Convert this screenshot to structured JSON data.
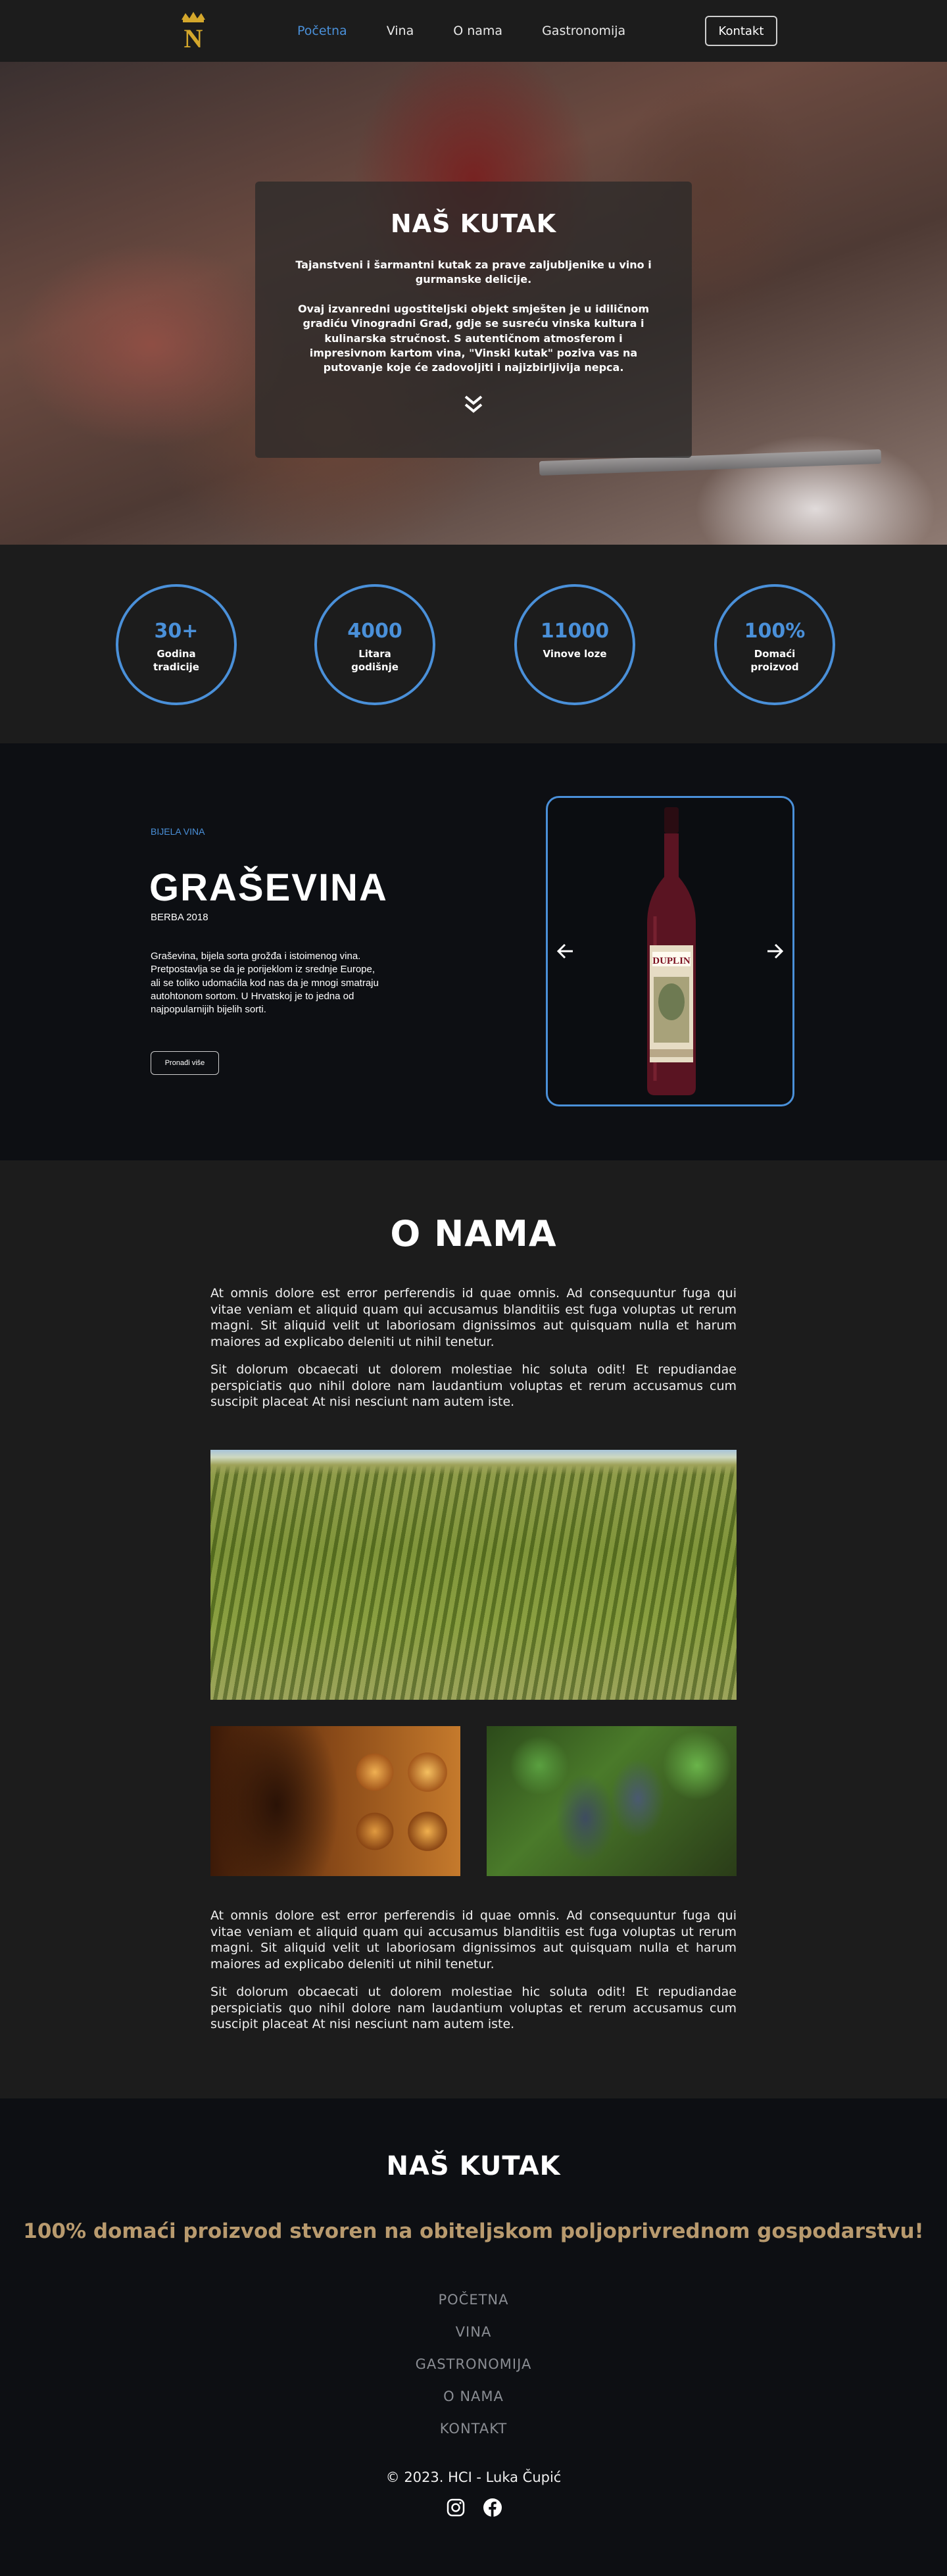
{
  "nav": {
    "links": [
      "Početna",
      "Vina",
      "O nama",
      "Gastronomija"
    ],
    "active_index": 0,
    "cta": "Kontakt",
    "logo_letter": "N"
  },
  "hero": {
    "title": "NAŠ KUTAK",
    "lead": "Tajanstveni i šarmantni kutak za prave zaljubljenike u vino i gurmanske delicije.",
    "body": "Ovaj izvanredni ugostiteljski objekt smješten je u idiličnom gradiću Vinogradni Grad, gdje se susreću vinska kultura i kulinarska stručnost. S autentičnom atmosferom i impresivnom kartom vina, \"Vinski kutak\" poziva vas na putovanje koje će zadovoljiti i najizbirljivija nepca.",
    "scroll_icon": "double-chevron-down-icon"
  },
  "stats": [
    {
      "value": "30+",
      "label": "Godina tradicije"
    },
    {
      "value": "4000",
      "label": "Litara godišnje"
    },
    {
      "value": "11000",
      "label": "Vinove loze"
    },
    {
      "value": "100%",
      "label": "Domaći proizvod"
    }
  ],
  "wine": {
    "category": "BIJELA VINA",
    "name": "GRAŠEVINA",
    "vintage": "BERBA 2018",
    "description": "Graševina, bijela sorta grožđa i istoimenog vina. Pretpostavlja se da je porijeklom iz srednje Europe, ali se toliko udomaćila kod nas da je mnogi smatraju autohtonom sortom. U Hrvatskoj je to jedna od najpopularnijih bijelih sorti.",
    "button": "Pronađi više",
    "bottle_label": "DUPLIN"
  },
  "about": {
    "title": "O NAMA",
    "p1": "At omnis dolore est error perferendis id quae omnis. Ad consequuntur fuga qui vitae veniam et aliquid quam qui accusamus blanditiis est fuga voluptas ut rerum magni. Sit aliquid velit ut laboriosam dignissimos aut quisquam nulla et harum maiores ad explicabo deleniti ut nihil tenetur.",
    "p2": "Sit dolorum obcaecati ut dolorem molestiae hic soluta odit! Et repudiandae perspiciatis quo nihil dolore nam laudantium voluptas et rerum accusamus cum suscipit placeat At nisi nesciunt nam autem iste.",
    "p3": "At omnis dolore est error perferendis id quae omnis. Ad consequuntur fuga qui vitae veniam et aliquid quam qui accusamus blanditiis est fuga voluptas ut rerum magni. Sit aliquid velit ut laboriosam dignissimos aut quisquam nulla et harum maiores ad explicabo deleniti ut nihil tenetur.",
    "p4": "Sit dolorum obcaecati ut dolorem molestiae hic soluta odit! Et repudiandae perspiciatis quo nihil dolore nam laudantium voluptas et rerum accusamus cum suscipit placeat At nisi nesciunt nam autem iste."
  },
  "footer": {
    "title": "NAŠ KUTAK",
    "tagline": "100% domaći proizvod stvoren na obiteljskom poljoprivrednom gospodarstvu!",
    "links": [
      "POČETNA",
      "VINA",
      "GASTRONOMIJA",
      "O NAMA",
      "KONTAKT"
    ],
    "copyright": "© 2023. HCI - Luka Čupić",
    "social": [
      "instagram-icon",
      "facebook-icon"
    ]
  },
  "colors": {
    "accent": "#4a90d9",
    "gold": "#b89a6e",
    "background": "#1c1c1c",
    "background_dark": "#0d0f13"
  }
}
